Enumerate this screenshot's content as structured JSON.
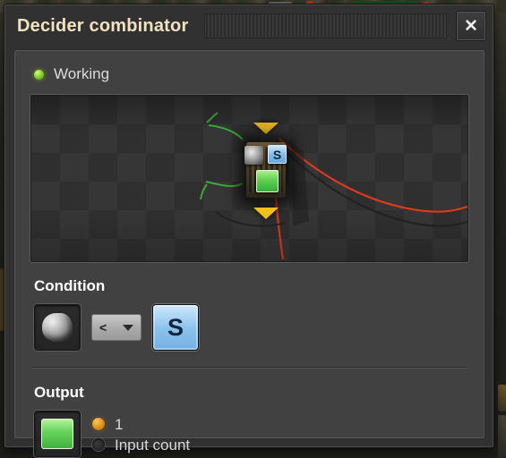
{
  "window": {
    "title": "Decider combinator",
    "close_label": "✕",
    "close_icon": "close-icon",
    "drag_handle_icon": "drag-handle-grip"
  },
  "status": {
    "label": "Working",
    "led_color": "#8ed13a",
    "led_icon": "status-led-icon"
  },
  "preview": {
    "entity_icon": "decider-combinator-entity",
    "input_arrow_icon": "input-arrow-icon",
    "output_arrow_icon": "output-arrow-icon",
    "overlay_left_icon": "stone-signal-icon",
    "overlay_right_label": "S",
    "overlay_output_icon": "green-signal-icon",
    "wire_red_color": "#e8391b",
    "wire_green_color": "#3da83d"
  },
  "condition": {
    "heading": "Condition",
    "first_signal_icon": "stone-item-icon",
    "comparator": "<",
    "comparator_caret_icon": "chevron-down-icon",
    "second_signal_label": "S"
  },
  "output": {
    "heading": "Output",
    "signal_icon": "green-signal-icon",
    "options": [
      {
        "label": "1",
        "selected": true
      },
      {
        "label": "Input count",
        "selected": false
      }
    ]
  },
  "colors": {
    "panel": "#414141",
    "window": "#313131",
    "title_text": "#f3e2c0",
    "accent_orange": "#e8981c",
    "signal_blue": "#8cc3ec",
    "signal_green": "#66d45c"
  }
}
